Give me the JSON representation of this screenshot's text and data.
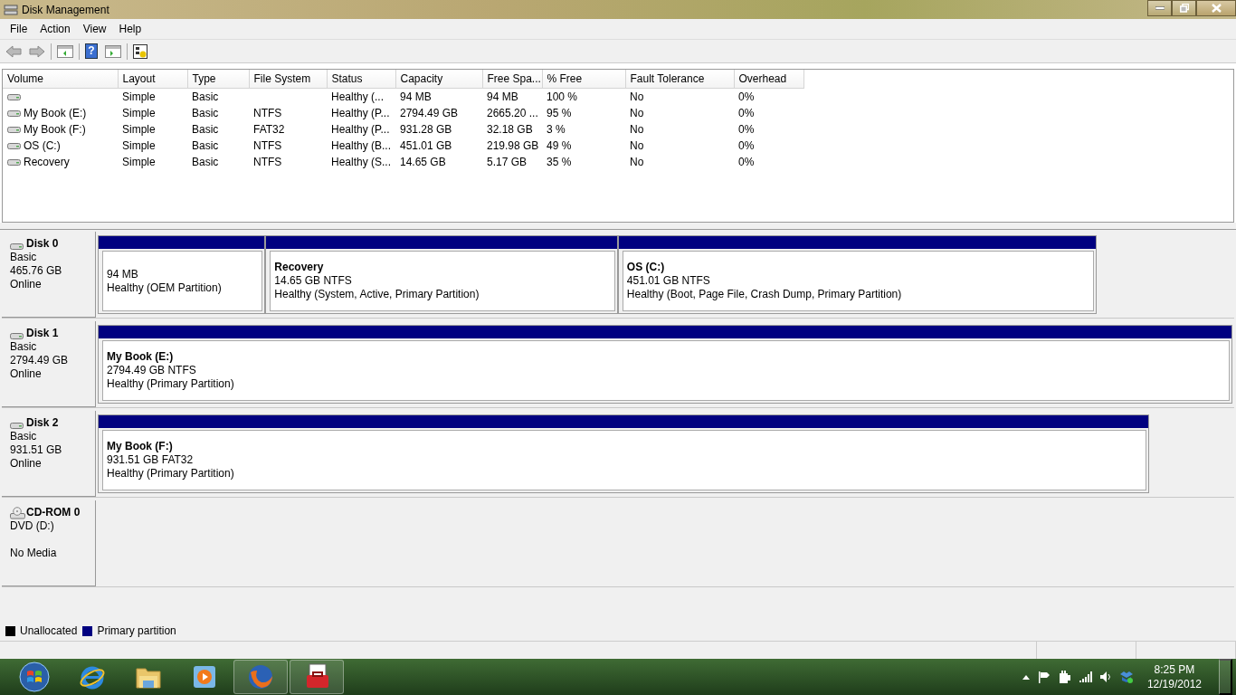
{
  "window": {
    "title": "Disk Management"
  },
  "menu": [
    "File",
    "Action",
    "View",
    "Help"
  ],
  "toolbar": {
    "help_glyph": "?"
  },
  "volume_table": {
    "columns": [
      "Volume",
      "Layout",
      "Type",
      "File System",
      "Status",
      "Capacity",
      "Free Spa...",
      "% Free",
      "Fault Tolerance",
      "Overhead"
    ],
    "rows": [
      [
        "",
        "Simple",
        "Basic",
        "",
        "Healthy (...",
        "94 MB",
        "94 MB",
        "100 %",
        "No",
        "0%"
      ],
      [
        "My Book (E:)",
        "Simple",
        "Basic",
        "NTFS",
        "Healthy (P...",
        "2794.49 GB",
        "2665.20 ...",
        "95 %",
        "No",
        "0%"
      ],
      [
        "My Book (F:)",
        "Simple",
        "Basic",
        "FAT32",
        "Healthy (P...",
        "931.28 GB",
        "32.18 GB",
        "3 %",
        "No",
        "0%"
      ],
      [
        "OS (C:)",
        "Simple",
        "Basic",
        "NTFS",
        "Healthy (B...",
        "451.01 GB",
        "219.98 GB",
        "49 %",
        "No",
        "0%"
      ],
      [
        "Recovery",
        "Simple",
        "Basic",
        "NTFS",
        "Healthy (S...",
        "14.65 GB",
        "5.17 GB",
        "35 %",
        "No",
        "0%"
      ]
    ]
  },
  "disks": [
    {
      "kind": "disk",
      "name": "Disk 0",
      "type": "Basic",
      "size": "465.76 GB",
      "status": "Online",
      "partitions": [
        {
          "size": "94 MB",
          "status": "Healthy (OEM Partition)"
        },
        {
          "name": "Recovery",
          "size": "14.65 GB NTFS",
          "status": "Healthy (System, Active, Primary Partition)"
        },
        {
          "name": "OS  (C:)",
          "size": "451.01 GB NTFS",
          "status": "Healthy (Boot, Page File, Crash Dump, Primary Partition)"
        }
      ]
    },
    {
      "kind": "disk",
      "name": "Disk 1",
      "type": "Basic",
      "size": "2794.49 GB",
      "status": "Online",
      "partitions": [
        {
          "name": "My Book  (E:)",
          "size": "2794.49 GB NTFS",
          "status": "Healthy (Primary Partition)"
        }
      ]
    },
    {
      "kind": "disk",
      "name": "Disk 2",
      "type": "Basic",
      "size": "931.51 GB",
      "status": "Online",
      "partitions": [
        {
          "name": "My Book  (F:)",
          "size": "931.51 GB FAT32",
          "status": "Healthy (Primary Partition)"
        }
      ]
    },
    {
      "kind": "cdrom",
      "name": "CD-ROM 0",
      "type": "DVD (D:)",
      "status": "No Media"
    }
  ],
  "legend": [
    {
      "label": "Unallocated",
      "color": "#000000"
    },
    {
      "label": "Primary partition",
      "color": "#000080"
    }
  ],
  "taskbar": {
    "buttons": [
      {
        "kind": "ie",
        "running": false
      },
      {
        "kind": "folder",
        "running": false
      },
      {
        "kind": "media",
        "running": false
      },
      {
        "kind": "firefox",
        "running": true
      },
      {
        "kind": "toolbox",
        "running": true
      }
    ],
    "time": "8:25 PM",
    "date": "12/19/2012"
  }
}
